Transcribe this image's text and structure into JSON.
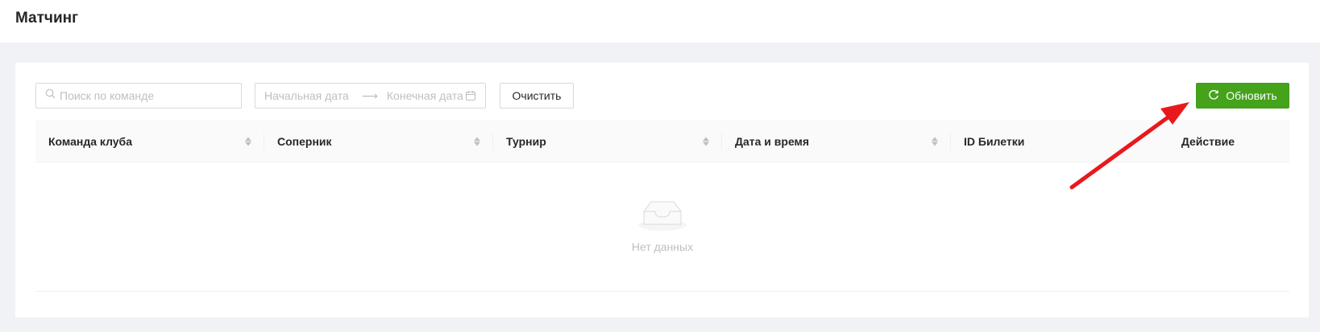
{
  "header": {
    "title": "Матчинг"
  },
  "filters": {
    "search_placeholder": "Поиск по команде",
    "date_start_placeholder": "Начальная дата",
    "date_end_placeholder": "Конечная дата",
    "clear_label": "Очистить",
    "refresh_label": "Обновить"
  },
  "table": {
    "columns": [
      {
        "label": "Команда клуба",
        "sortable": true
      },
      {
        "label": "Соперник",
        "sortable": true
      },
      {
        "label": "Турнир",
        "sortable": true
      },
      {
        "label": "Дата и время",
        "sortable": true
      },
      {
        "label": "ID Билетки",
        "sortable": false
      },
      {
        "label": "Действие",
        "sortable": false
      }
    ],
    "rows": [],
    "empty_text": "Нет данных"
  },
  "colors": {
    "primary_button": "#44a21b",
    "annotation_arrow": "#e8191c"
  }
}
